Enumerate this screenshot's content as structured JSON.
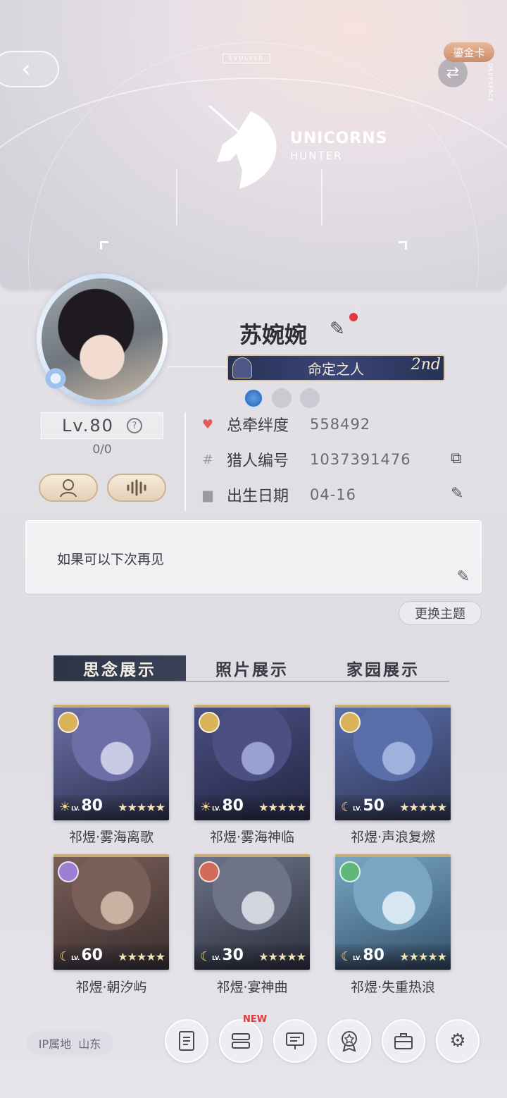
{
  "banner": {
    "back_icon": "chevron-left-icon",
    "evolver_tag": "EVOLVER",
    "logo_line1": "UNICORNS",
    "logo_line2": "HUNTER",
    "gold_card_label": "鎏金卡",
    "swap_icon": "swap-icon",
    "side_text": "DEEPSPACE"
  },
  "profile": {
    "name": "苏婉婉",
    "title": "命定之人",
    "title_rank": "2nd",
    "level_label": "Lv.80",
    "level_sub": "0/0",
    "pill1_icon": "avatar-outline-icon",
    "pill2_icon": "voice-wave-icon"
  },
  "info": [
    {
      "icon": "heart-icon",
      "label": "总牵绊度",
      "value": "558492",
      "action": ""
    },
    {
      "icon": "hash-icon",
      "label": "猎人编号",
      "value": "1037391476",
      "action": "copy-icon"
    },
    {
      "icon": "cake-icon",
      "label": "出生日期",
      "value": "04-16",
      "action": "edit-icon"
    }
  ],
  "signature": {
    "text": "如果可以下次再见"
  },
  "theme_button": "更换主题",
  "tabs": [
    {
      "label": "思念展示",
      "active": true
    },
    {
      "label": "照片展示",
      "active": false
    },
    {
      "label": "家园展示",
      "active": false
    }
  ],
  "cards": [
    {
      "label": "祁煜·雾海离歌",
      "level": "80",
      "phase": "sun",
      "badge_color": "#d9b35a",
      "stars": "★★★★★"
    },
    {
      "label": "祁煜·雾海神临",
      "level": "80",
      "phase": "sun",
      "badge_color": "#d9b35a",
      "stars": "★★★★★"
    },
    {
      "label": "祁煜·声浪复燃",
      "level": "50",
      "phase": "moon",
      "badge_color": "#d9b35a",
      "stars": "★★★★★"
    },
    {
      "label": "祁煜·朝汐屿",
      "level": "60",
      "phase": "moon",
      "badge_color": "#9b7fd0",
      "stars": "★★★★★"
    },
    {
      "label": "祁煜·宴神曲",
      "level": "30",
      "phase": "moon",
      "badge_color": "#d26a5a",
      "stars": "★★★★★"
    },
    {
      "label": "祁煜·失重热浪",
      "level": "80",
      "phase": "moon",
      "badge_color": "#5fb87a",
      "stars": "★★★★★"
    }
  ],
  "footer": {
    "ip_label": "IP属地",
    "ip_value": "山东",
    "new_badge": "NEW",
    "nav_icons": [
      "document-icon",
      "list-icon",
      "presentation-icon",
      "medal-icon",
      "briefcase-icon",
      "settings-icon"
    ]
  },
  "colors": {
    "accent_gold": "#c9ae74",
    "tab_active_bg": "#2d3446",
    "heart": "#e05a5a",
    "notify_red": "#e2373c"
  }
}
